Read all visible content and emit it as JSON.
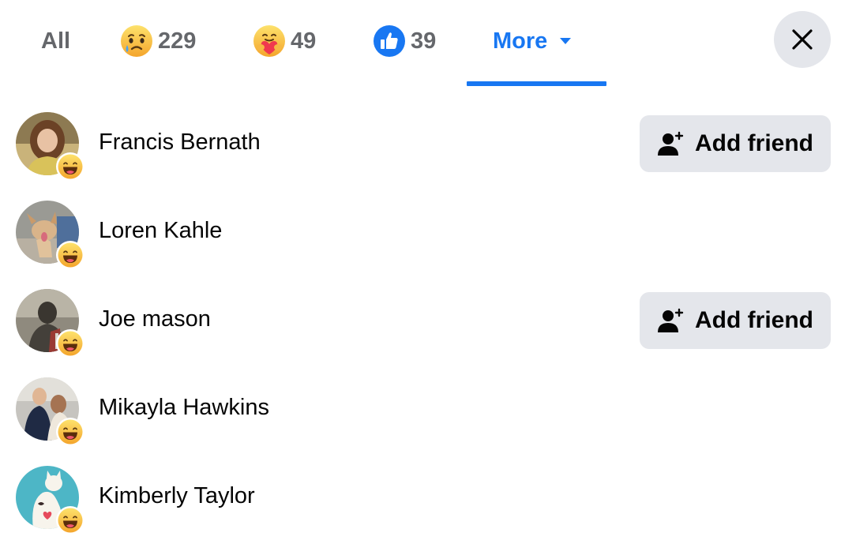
{
  "tabs": {
    "all_label": "All",
    "sad_count": "229",
    "care_count": "49",
    "like_count": "39",
    "more_label": "More",
    "active": "More"
  },
  "reactions": {
    "list_reaction_icon": "haha-reaction-icon"
  },
  "people": [
    {
      "name": "Francis Bernath",
      "action": "Add friend"
    },
    {
      "name": "Loren Kahle"
    },
    {
      "name": "Joe mason",
      "action": "Add friend"
    },
    {
      "name": "Mikayla Hawkins"
    },
    {
      "name": "Kimberly Taylor"
    }
  ],
  "colors": {
    "accent": "#1877f2",
    "button_bg": "#e4e6eb",
    "muted_text": "#65676b",
    "text": "#050505"
  }
}
